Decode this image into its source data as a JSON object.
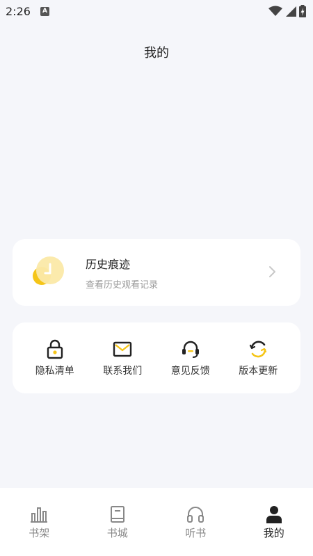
{
  "status_bar": {
    "time": "2:26",
    "notification_icon_letter": "A",
    "icons": [
      "wifi-icon",
      "signal-icon",
      "battery-charging-icon"
    ]
  },
  "page": {
    "title": "我的"
  },
  "history": {
    "title": "历史痕迹",
    "subtitle": "查看历史观看记录",
    "icon": "clock-icon",
    "accent": "#f5c518"
  },
  "menu": {
    "items": [
      {
        "label": "隐私清单",
        "icon": "lock-icon"
      },
      {
        "label": "联系我们",
        "icon": "mail-icon"
      },
      {
        "label": "意见反馈",
        "icon": "headset-icon"
      },
      {
        "label": "版本更新",
        "icon": "refresh-icon"
      }
    ]
  },
  "bottom_nav": {
    "items": [
      {
        "label": "书架",
        "icon": "bar-chart-icon",
        "active": false
      },
      {
        "label": "书城",
        "icon": "book-icon",
        "active": false
      },
      {
        "label": "听书",
        "icon": "headphones-icon",
        "active": false
      },
      {
        "label": "我的",
        "icon": "person-icon",
        "active": true
      }
    ]
  },
  "colors": {
    "background": "#f5f6fa",
    "card": "#ffffff",
    "accent_yellow": "#f5c518",
    "text_primary": "#222222",
    "text_secondary": "#999999",
    "nav_inactive": "#888888"
  }
}
